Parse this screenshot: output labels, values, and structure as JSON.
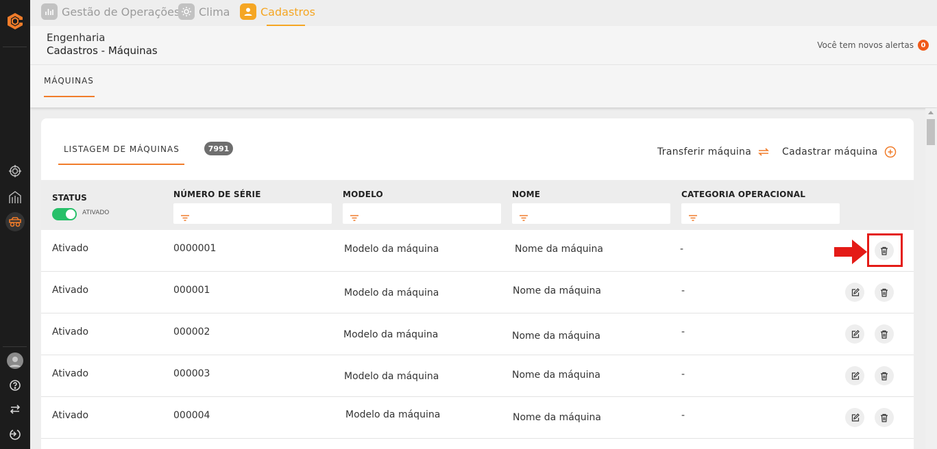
{
  "nav": {
    "items": [
      {
        "label": "Gestão de Operações",
        "icon": "chart-icon"
      },
      {
        "label": "Clima",
        "icon": "sun-icon"
      },
      {
        "label": "Cadastros",
        "icon": "user-icon"
      }
    ]
  },
  "header": {
    "subtitle": "Engenharia",
    "title": "Cadastros - Máquinas",
    "alerts_label": "Você tem novos alertas",
    "alerts_count": "0"
  },
  "tabs": {
    "active": "MÁQUINAS"
  },
  "card": {
    "tab_label": "LISTAGEM DE MÁQUINAS",
    "count": "7991",
    "transfer_label": "Transferir máquina",
    "register_label": "Cadastrar máquina"
  },
  "filters": {
    "status_label": "STATUS",
    "toggle_label": "ATIVADO",
    "columns": [
      "NÚMERO DE SÉRIE",
      "MODELO",
      "NOME",
      "CATEGORIA OPERACIONAL"
    ]
  },
  "rows": [
    {
      "status": "Ativado",
      "serial": "0000001",
      "model": "Modelo da máquina",
      "name": "Nome da máquina",
      "category": "-"
    },
    {
      "status": "Ativado",
      "serial": "000001",
      "model": "Modelo da máquina",
      "name": "Nome da máquina",
      "category": "-"
    },
    {
      "status": "Ativado",
      "serial": "000002",
      "model": "Modelo da máquina",
      "name": "Nome da máquina",
      "category": "-"
    },
    {
      "status": "Ativado",
      "serial": "000003",
      "model": "Modelo da máquina",
      "name": "Nome da máquina",
      "category": "-"
    },
    {
      "status": "Ativado",
      "serial": "000004",
      "model": "Modelo da máquina",
      "name": "Nome da máquina",
      "category": "-"
    }
  ],
  "colors": {
    "accent": "#f07c2a",
    "nav_active": "#f5a623",
    "toggle_on": "#27c069",
    "annotation": "#e41b17",
    "rail_bg": "#1c1c1c"
  }
}
